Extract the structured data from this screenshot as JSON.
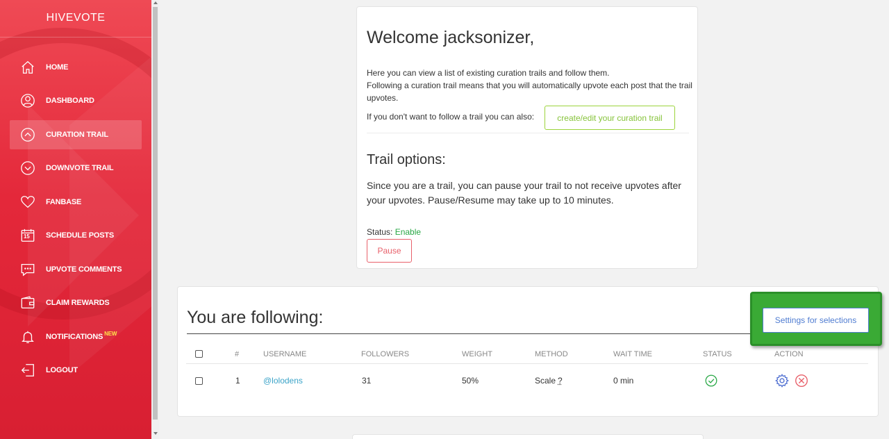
{
  "sidebar": {
    "brand": "HIVEVOTE",
    "items": [
      {
        "label": "HOME"
      },
      {
        "label": "DASHBOARD"
      },
      {
        "label": "CURATION TRAIL"
      },
      {
        "label": "DOWNVOTE TRAIL"
      },
      {
        "label": "FANBASE"
      },
      {
        "label": "SCHEDULE POSTS",
        "calendar_day": "15"
      },
      {
        "label": "UPVOTE COMMENTS"
      },
      {
        "label": "CLAIM REWARDS"
      },
      {
        "label": "NOTIFICATIONS",
        "badge": "NEW"
      },
      {
        "label": "LOGOUT"
      }
    ]
  },
  "welcome": {
    "title": "Welcome jacksonizer,",
    "intro_line1": "Here you can view a list of existing curation trails and follow them.",
    "intro_line2": "Following a curation trail means that you will automatically upvote each post that the trail upvotes.",
    "alt_text": "If you don't want to follow a trail you can also:",
    "create_button": "create/edit your curation trail",
    "options_title": "Trail options:",
    "options_text": "Since you are a trail, you can pause your trail to not receive upvotes after your upvotes. Pause/Resume may take up to 10 minutes.",
    "status_label": "Status:",
    "status_value": "Enable",
    "pause_button": "Pause"
  },
  "following": {
    "title": "You are following:",
    "settings_button": "Settings for selections",
    "columns": [
      "#",
      "USERNAME",
      "FOLLOWERS",
      "WEIGHT",
      "METHOD",
      "WAIT TIME",
      "STATUS",
      "ACTION"
    ],
    "rows": [
      {
        "num": "1",
        "username": "@lolodens",
        "followers": "31",
        "weight": "50%",
        "method": "Scale",
        "method_hint": "?",
        "wait_time": "0 min",
        "status_icon": "check-circle-icon"
      }
    ]
  },
  "colors": {
    "sidebar": "#e4283a",
    "green_button": "#86c33a",
    "red_button": "#e8606a",
    "blue_button": "#4f7cd1",
    "link": "#3aa3c8",
    "highlight": "#3aaa35"
  }
}
